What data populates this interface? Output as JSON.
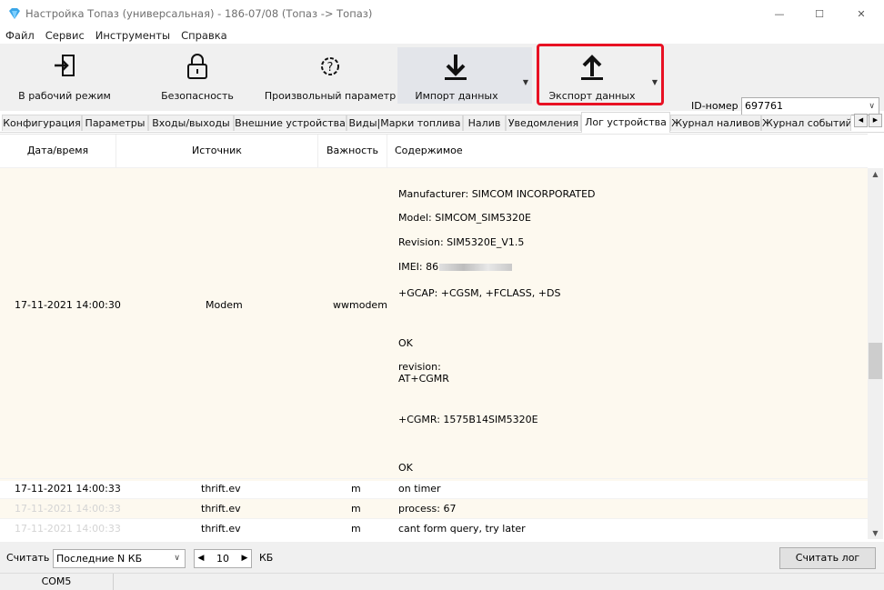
{
  "window": {
    "title": "Настройка Топаз (универсальная) - 186-07/08 (Топаз -> Топаз)",
    "minimize": "—",
    "maximize": "☐",
    "close": "✕"
  },
  "menu": [
    "Файл",
    "Сервис",
    "Инструменты",
    "Справка"
  ],
  "toolbar": {
    "work_mode": "В рабочий режим",
    "security": "Безопасность",
    "custom_param": "Произвольный параметр",
    "import": "Импорт данных",
    "export": "Экспорт данных",
    "id_label": "ID-номер",
    "id_value": "697761"
  },
  "tabs": [
    "Конфигурация",
    "Параметры",
    "Входы/выходы",
    "Внешние устройства",
    "Виды|Марки топлива",
    "Налив",
    "Уведомления",
    "Лог устройства",
    "Журнал наливов",
    "Журнал событий"
  ],
  "active_tab": "Лог устройства",
  "grid": {
    "headers": [
      "Дата/время",
      "Источник",
      "Важность",
      "Содержимое"
    ],
    "big_row": {
      "datetime": "17-11-2021 14:00:30",
      "source": "Modem",
      "severity": "wwmodem",
      "lines": [
        "Manufacturer: SIMCOM INCORPORATED",
        "Model: SIMCOM_SIM5320E",
        "Revision: SIM5320E_V1.5",
        "IMEI: 86",
        "+GCAP: +CGSM, +FCLASS, +DS",
        "OK",
        "revision:",
        "AT+CGMR",
        "+CGMR: 1575B14SIM5320E",
        "OK"
      ]
    },
    "rows": [
      {
        "datetime": "17-11-2021 14:00:33",
        "source": "thrift.ev",
        "severity": "m",
        "content": "on timer"
      },
      {
        "datetime": "17-11-2021 14:00:33",
        "source": "thrift.ev",
        "severity": "m",
        "content": "process: 67"
      },
      {
        "datetime": "17-11-2021 14:00:33",
        "source": "thrift.ev",
        "severity": "m",
        "content": "cant form query, try later"
      }
    ]
  },
  "bottom": {
    "read_label": "Считать",
    "mode": "Последние N КБ",
    "amount": "10",
    "unit": "КБ",
    "read_log": "Считать лог"
  },
  "status": {
    "port": "COM5"
  },
  "colors": {
    "highlight": "#e81123",
    "row_alt": "#fdf9ef"
  }
}
